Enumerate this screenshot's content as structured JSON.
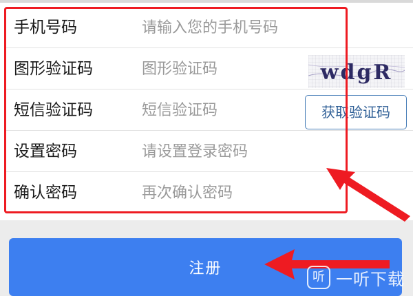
{
  "form": {
    "rows": [
      {
        "label": "手机号码",
        "placeholder": "请输入您的手机号码"
      },
      {
        "label": "图形验证码",
        "placeholder": "图形验证码"
      },
      {
        "label": "短信验证码",
        "placeholder": "短信验证码"
      },
      {
        "label": "设置密码",
        "placeholder": "请设置登录密码"
      },
      {
        "label": "确认密码",
        "placeholder": "再次确认密码"
      }
    ],
    "captcha_text": "wdgR",
    "sms_button_label": "获取验证码",
    "register_button_label": "注册"
  },
  "annotations": {
    "highlight_color": "#ee1b22",
    "arrow_color": "#ee1b22",
    "arrows": [
      "arrow-to-form",
      "arrow-to-register-button"
    ]
  },
  "watermark": {
    "icon": "ting-logo-icon",
    "icon_char": "听",
    "text": "一听下载"
  },
  "colors": {
    "primary_button": "#3d7ff0",
    "sms_button_border": "#4a7fb8",
    "label_text": "#1a1a1a",
    "placeholder_text": "#9a9a9a"
  }
}
